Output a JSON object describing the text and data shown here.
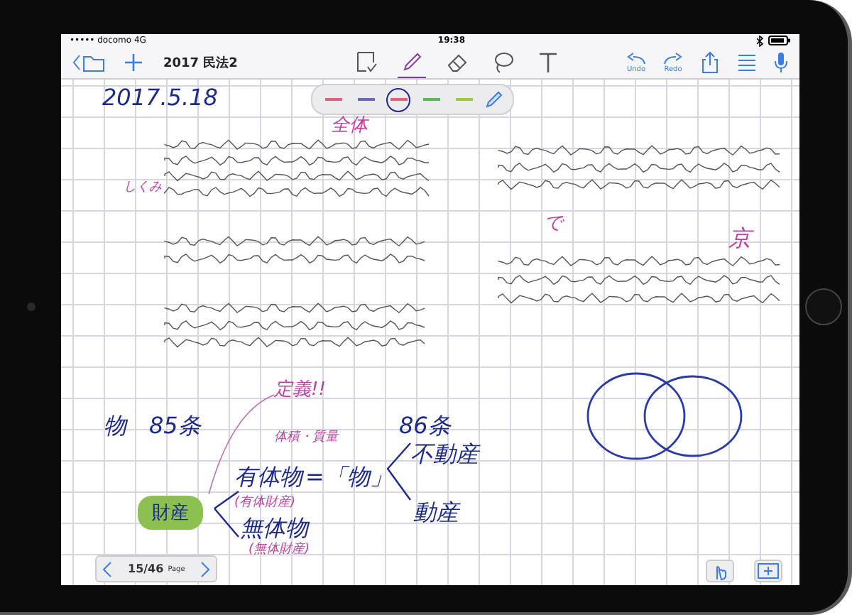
{
  "status_bar": {
    "carrier": "••••• docomo",
    "network": "4G",
    "time": "19:38"
  },
  "toolbar": {
    "title": "2017 民法2",
    "tools": [
      {
        "kind": "select",
        "selected": false
      },
      {
        "kind": "pen",
        "selected": true
      },
      {
        "kind": "eraser",
        "selected": false
      },
      {
        "kind": "lasso",
        "selected": false
      },
      {
        "kind": "text",
        "selected": false
      }
    ],
    "undo": "Undo",
    "redo": "Redo"
  },
  "pen_palette": [
    {
      "color": "#e06080",
      "selected": false
    },
    {
      "color": "#6a6ab8",
      "selected": false
    },
    {
      "color": "#e06080",
      "selected": true
    },
    {
      "color": "#5cb85c",
      "selected": false
    },
    {
      "color": "#9acd32",
      "selected": false
    }
  ],
  "note": {
    "handwriting": [
      {
        "text": "2017.5.18",
        "color": "#1d2a8c"
      },
      {
        "text": "全体",
        "color": "#c040a0"
      },
      {
        "text": "しくみ",
        "color": "#c040a0"
      },
      {
        "text": "で",
        "color": "#c040a0"
      },
      {
        "text": "京",
        "color": "#c040a0"
      },
      {
        "text": "定義!!",
        "color": "#c040a0"
      },
      {
        "text": "物",
        "color": "#1d2a8c"
      },
      {
        "text": "85条",
        "color": "#1d2a8c"
      },
      {
        "text": "体積・質量",
        "color": "#c040a0"
      },
      {
        "text": "86条",
        "color": "#1d2a8c"
      },
      {
        "text": "不動産",
        "color": "#1d2a8c"
      },
      {
        "text": "有体物",
        "color": "#1d2a8c"
      },
      {
        "text": "=「物」",
        "color": "#1d2a8c"
      },
      {
        "text": "(有体財産)",
        "color": "#c040a0"
      },
      {
        "text": "動産",
        "color": "#1d2a8c"
      },
      {
        "text": "無体物",
        "color": "#1d2a8c"
      },
      {
        "text": "(無体財産)",
        "color": "#c040a0"
      }
    ],
    "highlight": {
      "text": "財産",
      "color": "#8cc152"
    }
  },
  "pager": {
    "current": "15/46",
    "label": "Page"
  }
}
